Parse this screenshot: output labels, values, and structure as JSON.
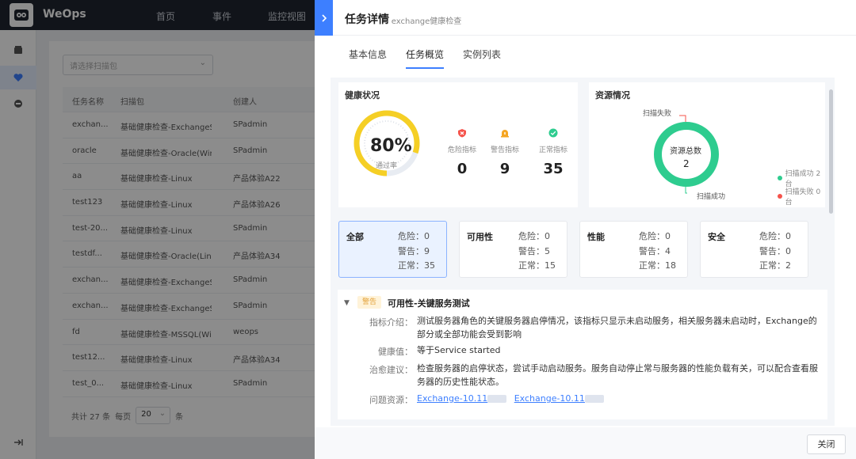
{
  "app": {
    "brand": "WeOps",
    "nav": [
      "首页",
      "事件",
      "监控视图"
    ]
  },
  "background": {
    "select_placeholder": "请选择扫描包",
    "columns": [
      "任务名称",
      "扫描包",
      "创建人"
    ],
    "rows": [
      [
        "exchan...",
        "基础健康检查-ExchangeSe...",
        "SPadmin"
      ],
      [
        "oracle",
        "基础健康检查-Oracle(Win...",
        "SPadmin"
      ],
      [
        "aa",
        "基础健康检查-Linux",
        "产品体验A22"
      ],
      [
        "test123",
        "基础健康检查-Linux",
        "产品体验A26"
      ],
      [
        "test-20...",
        "基础健康检查-Linux",
        "SPadmin"
      ],
      [
        "testdf...",
        "基础健康检查-Oracle(Linux)",
        "产品体验A34"
      ],
      [
        "exchan...",
        "基础健康检查-ExchangeSe...",
        "SPadmin"
      ],
      [
        "exchan...",
        "基础健康检查-ExchangeSe...",
        "SPadmin"
      ],
      [
        "fd",
        "基础健康检查-MSSQL(Win...",
        "weops"
      ],
      [
        "test12...",
        "基础健康检查-Linux",
        "产品体验A34"
      ],
      [
        "test_0...",
        "基础健康检查-Linux",
        "SPadmin"
      ]
    ],
    "pager": {
      "total": "共计 27 条",
      "per_page_label": "每页",
      "per_page": "20",
      "unit": "条"
    }
  },
  "drawer": {
    "title": "任务详情",
    "subtitle": "- exchange健康检查",
    "tabs": [
      "基本信息",
      "任务概览",
      "实例列表"
    ],
    "active_tab": 1,
    "health": {
      "title": "健康状况",
      "pass_rate": 0.8,
      "pass_rate_text": "80%",
      "pass_rate_label": "通过率",
      "metrics": [
        {
          "label": "危险指标",
          "value": "0",
          "icon": "shield-danger-icon",
          "color": "#f5534b"
        },
        {
          "label": "警告指标",
          "value": "9",
          "icon": "alarm-warning-icon",
          "color": "#f5a623"
        },
        {
          "label": "正常指标",
          "value": "35",
          "icon": "check-circle-icon",
          "color": "#2ecc8f"
        }
      ]
    },
    "resource": {
      "title": "资源情况",
      "center_label": "资源总数",
      "center_value": "2",
      "callout_fail": "扫描失败",
      "callout_success": "扫描成功",
      "legend": [
        {
          "text": "扫描成功 2台",
          "color": "#2ecc8f"
        },
        {
          "text": "扫描失败 0台",
          "color": "#f5534b"
        }
      ]
    },
    "categories": [
      {
        "name": "全部",
        "danger": "危险：0",
        "warn": "警告：9",
        "normal": "正常：35"
      },
      {
        "name": "可用性",
        "danger": "危险：0",
        "warn": "警告：5",
        "normal": "正常：15"
      },
      {
        "name": "性能",
        "danger": "危险：0",
        "warn": "警告：4",
        "normal": "正常：18"
      },
      {
        "name": "安全",
        "danger": "危险：0",
        "warn": "警告：0",
        "normal": "正常：2"
      }
    ],
    "detail": {
      "tag": "警告",
      "title": "可用性-关键服务测试",
      "intro_label": "指标介绍：",
      "intro": "测试服务器角色的关键服务器启停情况，该指标只显示未启动服务，相关服务器未启动时，Exchange的部分或全部功能会受到影响",
      "health_label": "健康值：",
      "health": "等于Service started",
      "advice_label": "治愈建议：",
      "advice": "检查服务器的启停状态，尝试手动启动服务。服务自动停止常与服务器的性能负载有关，可以配合查看服务器的历史性能状态。",
      "resources_label": "问题资源：",
      "resources": [
        "Exchange-10.11",
        "Exchange-10.11"
      ]
    },
    "close": "关闭"
  }
}
